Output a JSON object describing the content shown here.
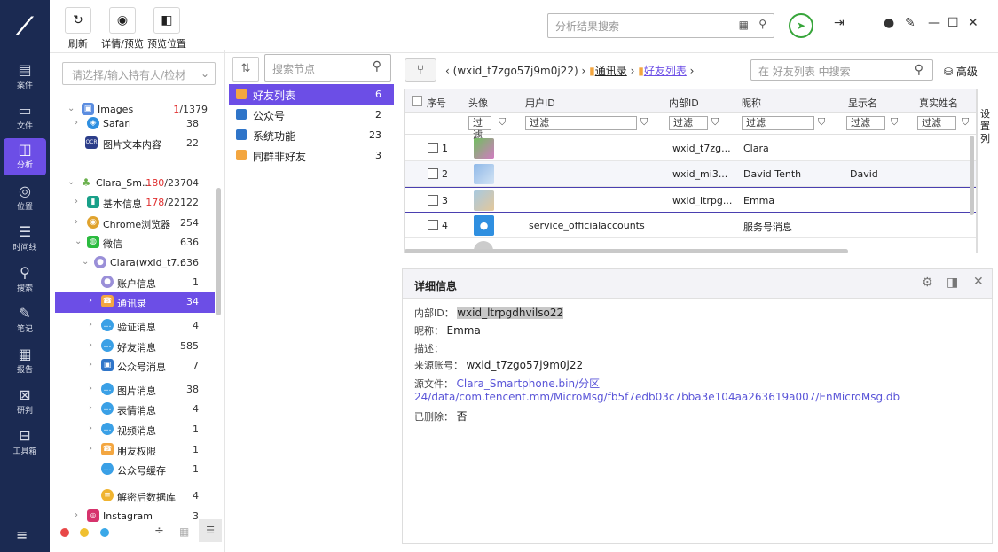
{
  "sidebar": {
    "items": [
      {
        "label": "案件",
        "icon": "case-icon"
      },
      {
        "label": "文件",
        "icon": "folder-icon"
      },
      {
        "label": "分析",
        "icon": "analysis-icon"
      },
      {
        "label": "位置",
        "icon": "location-icon"
      },
      {
        "label": "时间线",
        "icon": "timeline-icon"
      },
      {
        "label": "搜索",
        "icon": "search-icon"
      },
      {
        "label": "笔记",
        "icon": "note-icon"
      },
      {
        "label": "报告",
        "icon": "report-icon"
      },
      {
        "label": "研判",
        "icon": "judge-icon"
      },
      {
        "label": "工具箱",
        "icon": "toolbox-icon"
      }
    ],
    "active": "分析"
  },
  "toolbar": {
    "refresh": "刷新",
    "details_preview": "详情/预览",
    "preview_position": "预览位置"
  },
  "top_search": {
    "placeholder": "分析结果搜索"
  },
  "tree": {
    "placeholder": "请选择/输入持有人/检材",
    "rows": [
      {
        "label": "Images",
        "count_a": "1",
        "count_b": "/1379"
      },
      {
        "label": "Safari",
        "count": "38"
      },
      {
        "label": "图片文本内容",
        "count": "22",
        "badge": "OCR"
      },
      {
        "label": "Clara_Sm...",
        "count_a": "180",
        "count_b": "/23704"
      },
      {
        "label": "基本信息",
        "count_a": "178",
        "count_b": "/22122"
      },
      {
        "label": "Chrome浏览器",
        "count": "254"
      },
      {
        "label": "微信",
        "count": "636"
      },
      {
        "label": "Clara(wxid_t7...",
        "count": "636"
      },
      {
        "label": "账户信息",
        "count": "1"
      },
      {
        "label": "通讯录",
        "count": "34"
      },
      {
        "label": "验证消息",
        "count": "4"
      },
      {
        "label": "好友消息",
        "count": "585"
      },
      {
        "label": "公众号消息",
        "count": "7"
      },
      {
        "label": "图片消息",
        "count": "38"
      },
      {
        "label": "表情消息",
        "count": "4"
      },
      {
        "label": "视频消息",
        "count": "1"
      },
      {
        "label": "朋友权限",
        "count": "1"
      },
      {
        "label": "公众号缓存",
        "count": "1"
      },
      {
        "label": "解密后数据库",
        "count": "4"
      },
      {
        "label": "Instagram",
        "count": "3"
      }
    ]
  },
  "nodes": {
    "placeholder": "搜索节点",
    "items": [
      {
        "label": "好友列表",
        "count": "6"
      },
      {
        "label": "公众号",
        "count": "2"
      },
      {
        "label": "系统功能",
        "count": "23"
      },
      {
        "label": "同群非好友",
        "count": "3"
      }
    ]
  },
  "breadcrumb": {
    "part1": "(wxid_t7zgo57j9m0j22)",
    "part2": "通讯录",
    "part3": "好友列表"
  },
  "list_search": {
    "placeholder": "在 好友列表 中搜索"
  },
  "advanced": "高级",
  "grid": {
    "columns": [
      "序号",
      "头像",
      "用户ID",
      "内部ID",
      "昵称",
      "显示名",
      "真实姓名"
    ],
    "filter": "过滤",
    "settings": "设置列",
    "rows": [
      {
        "no": "1",
        "user_id": "",
        "internal_id": "wxid_t7zg...",
        "nickname": "Clara",
        "display": ""
      },
      {
        "no": "2",
        "user_id": "",
        "internal_id": "wxid_mi3...",
        "nickname": "David Tenth",
        "display": "David"
      },
      {
        "no": "3",
        "user_id": "",
        "internal_id": "wxid_ltrpg...",
        "nickname": "Emma",
        "display": ""
      },
      {
        "no": "4",
        "user_id": "service_officialaccounts",
        "internal_id": "",
        "nickname": "服务号消息",
        "display": ""
      }
    ]
  },
  "detail": {
    "title": "详细信息",
    "internal_id_label": "内部ID：",
    "internal_id": "wxid_ltrpgdhvilso22",
    "nickname_label": "昵称：",
    "nickname": "Emma",
    "desc_label": "描述：",
    "source_label": "来源账号：",
    "source": "wxid_t7zgo57j9m0j22",
    "file_label": "源文件：",
    "file_line1": "Clara_Smartphone.bin/分区",
    "file_line2": "24/data/com.tencent.mm/MicroMsg/fb5f7edb03c7bba3e104aa263619a007/EnMicroMsg.db",
    "deleted_label": "已删除：",
    "deleted": "否"
  }
}
